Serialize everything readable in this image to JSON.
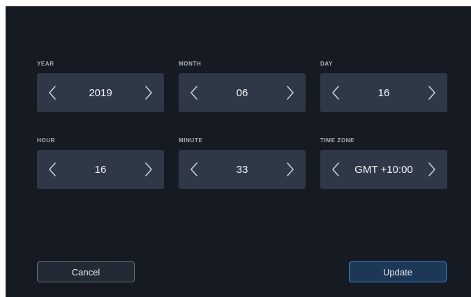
{
  "fields": {
    "year": {
      "label": "YEAR",
      "value": "2019"
    },
    "month": {
      "label": "MONTH",
      "value": "06"
    },
    "day": {
      "label": "DAY",
      "value": "16"
    },
    "hour": {
      "label": "HOUR",
      "value": "16"
    },
    "minute": {
      "label": "MINUTE",
      "value": "33"
    },
    "timezone": {
      "label": "TIME ZONE",
      "value": "GMT +10:00"
    }
  },
  "icons": {
    "decrement": "chevron-left-icon",
    "increment": "chevron-right-icon"
  },
  "buttons": {
    "cancel": "Cancel",
    "update": "Update"
  },
  "colors": {
    "background": "#161b23",
    "stepper": "#2e3847",
    "accent": "#3c86d6"
  }
}
